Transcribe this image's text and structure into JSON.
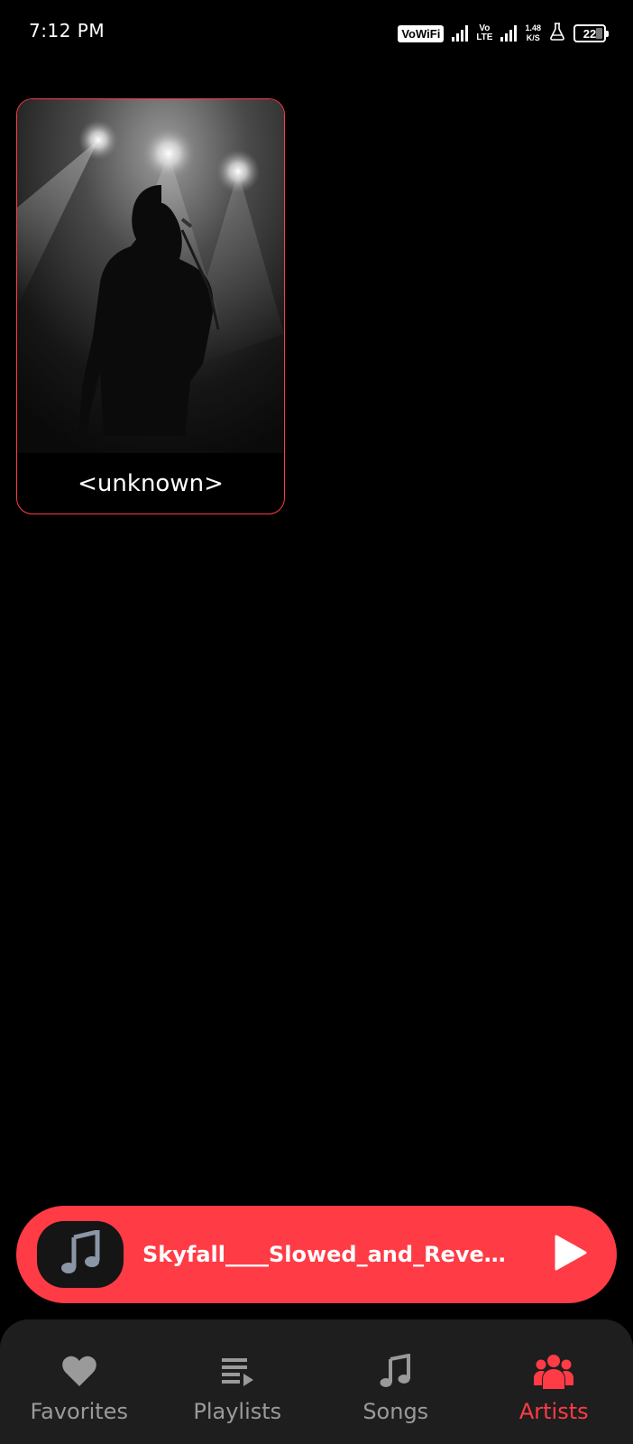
{
  "status_bar": {
    "time": "7:12 PM",
    "vowifi": "VoWiFi",
    "volte_top": "Vo",
    "volte_bottom": "LTE",
    "speed_value": "1.48",
    "speed_unit": "K/S",
    "battery": "22",
    "battery_percent": 22
  },
  "artists": [
    {
      "name": "<unknown>",
      "image": "singer-silhouette-spotlight"
    }
  ],
  "mini_player": {
    "title": "Skyfall____Slowed_and_Reve…",
    "art_icon": "music-note-icon",
    "play_icon": "play-icon"
  },
  "nav": {
    "items": [
      {
        "label": "Favorites",
        "icon": "heart-icon"
      },
      {
        "label": "Playlists",
        "icon": "playlist-icon"
      },
      {
        "label": "Songs",
        "icon": "music-note-icon"
      },
      {
        "label": "Artists",
        "icon": "artists-icon"
      }
    ],
    "active": "Artists"
  },
  "colors": {
    "accent": "#ff3b46",
    "background": "#000000",
    "nav_background": "#1e1e1e",
    "inactive": "#9a9a9a"
  }
}
